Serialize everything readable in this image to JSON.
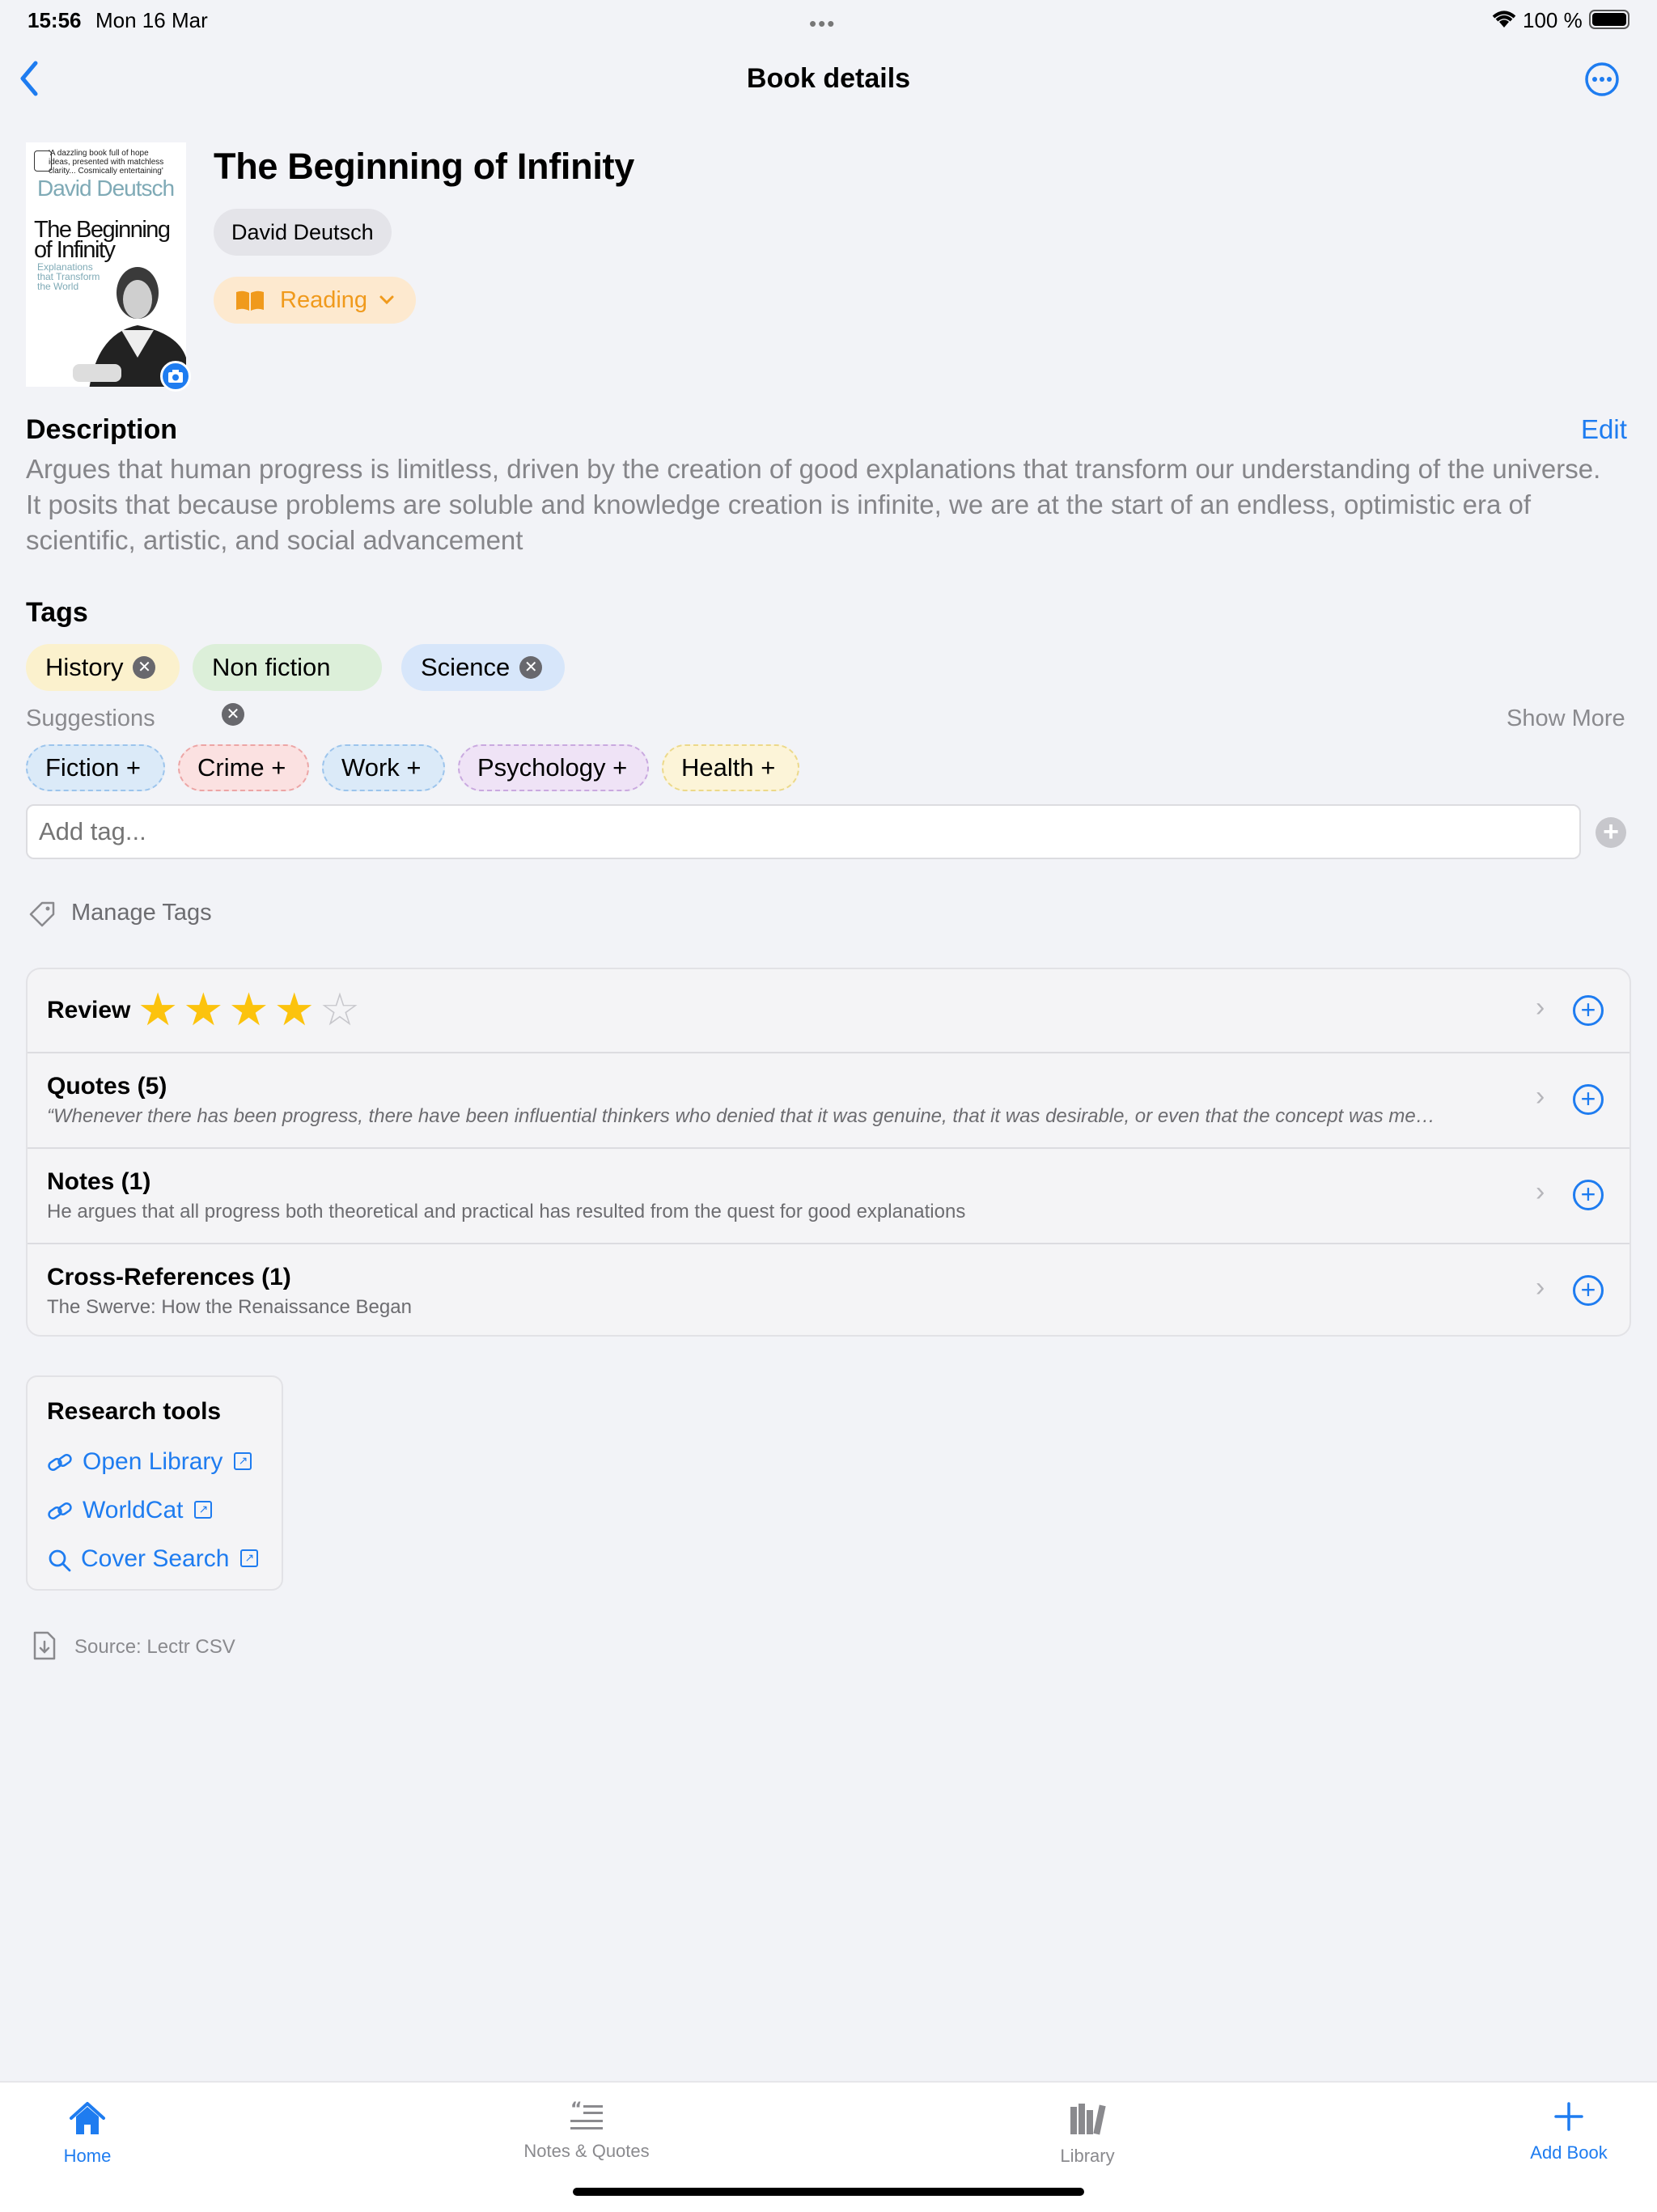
{
  "status_bar": {
    "time": "15:56",
    "date": "Mon 16 Mar",
    "battery": "100 %"
  },
  "nav": {
    "title": "Book details"
  },
  "book": {
    "title": "The Beginning of Infinity",
    "author": "David Deutsch",
    "status": "Reading",
    "cover": {
      "author": "David Deutsch",
      "title": "The Beginning of Infinity",
      "subtitle": "Explanations that Transform the World",
      "blurb": "'A dazzling book full of hope ideas, presented with matchless clarity... Cosmically entertaining'"
    }
  },
  "description": {
    "heading": "Description",
    "edit_label": "Edit",
    "text": "Argues that human progress is limitless, driven by the creation of good explanations that transform our understanding of the universe. It posits that because problems are soluble and knowledge creation is infinite, we are at the start of an endless, optimistic era of scientific, artistic, and social advancement"
  },
  "tags": {
    "heading": "Tags",
    "items": [
      {
        "label": "History",
        "color": "#fbf1cd"
      },
      {
        "label": "Non fiction",
        "color": "#dcefd9"
      },
      {
        "label": "Science",
        "color": "#d7e6fa"
      }
    ],
    "suggestions_label": "Suggestions",
    "show_more_label": "Show More",
    "suggestions": [
      {
        "label": "Fiction +",
        "color": "#dbeaf8",
        "border": "#9cc4ec"
      },
      {
        "label": "Crime +",
        "color": "#fbe1e1",
        "border": "#eca5a5"
      },
      {
        "label": "Work +",
        "color": "#dbeaf8",
        "border": "#9cc4ec"
      },
      {
        "label": "Psychology +",
        "color": "#efe3f6",
        "border": "#c9a9df"
      },
      {
        "label": "Health +",
        "color": "#fcf4d8",
        "border": "#ecd98a"
      }
    ],
    "add_placeholder": "Add tag...",
    "manage_label": "Manage Tags"
  },
  "details": {
    "review": {
      "label": "Review",
      "rating": 4,
      "max": 5
    },
    "quotes": {
      "label": "Quotes (5)",
      "preview": "“Whenever there has been progress, there have been influential thinkers who denied that it was genuine, that it was desirable, or even that the concept was me…"
    },
    "notes": {
      "label": "Notes (1)",
      "preview": "He argues that all progress both theoretical and practical has resulted from the quest for good explanations"
    },
    "crossrefs": {
      "label": "Cross-References (1)",
      "preview": "The Swerve: How the Renaissance Began"
    }
  },
  "research": {
    "heading": "Research tools",
    "links": [
      "Open Library",
      "WorldCat",
      "Cover Search"
    ]
  },
  "source": "Source: Lectr CSV",
  "tabbar": {
    "home": "Home",
    "notes": "Notes & Quotes",
    "library": "Library",
    "add": "Add Book"
  },
  "colors": {
    "accent": "#1e7cf0",
    "reading": "#f09a1c"
  }
}
